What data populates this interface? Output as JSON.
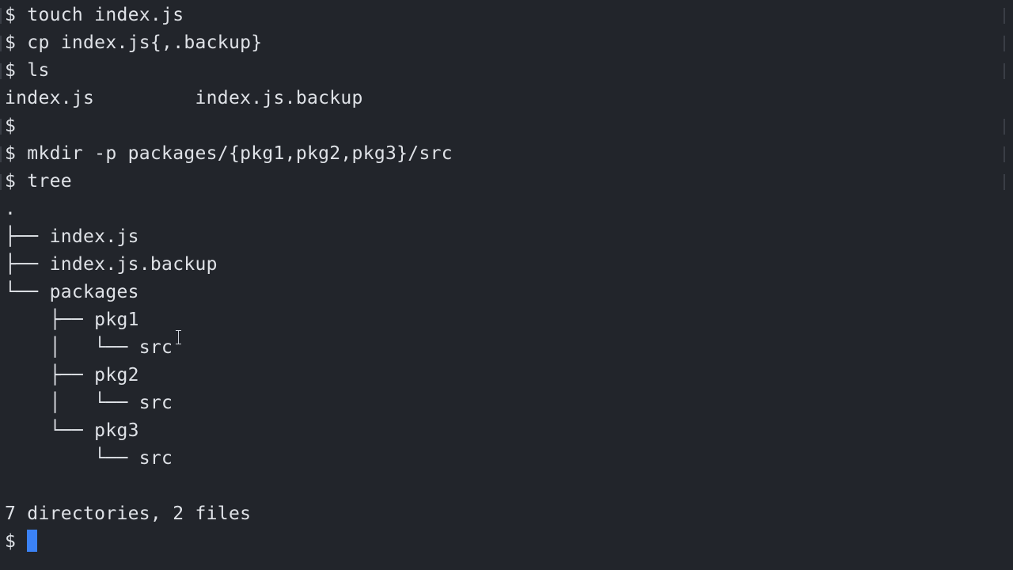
{
  "terminal": {
    "lines": [
      "$ touch index.js",
      "$ cp index.js{,.backup}",
      "$ ls",
      "index.js         index.js.backup",
      "$",
      "$ mkdir -p packages/{pkg1,pkg2,pkg3}/src",
      "$ tree",
      ".",
      "├── index.js",
      "├── index.js.backup",
      "└── packages",
      "    ├── pkg1",
      "    │   └── src",
      "    ├── pkg2",
      "    │   └── src",
      "    └── pkg3",
      "        └── src",
      "",
      "7 directories, 2 files"
    ],
    "prompt": "$ ",
    "cursor_color": "#3b82f6",
    "background": "#22252b",
    "foreground": "#dfe2e7"
  }
}
